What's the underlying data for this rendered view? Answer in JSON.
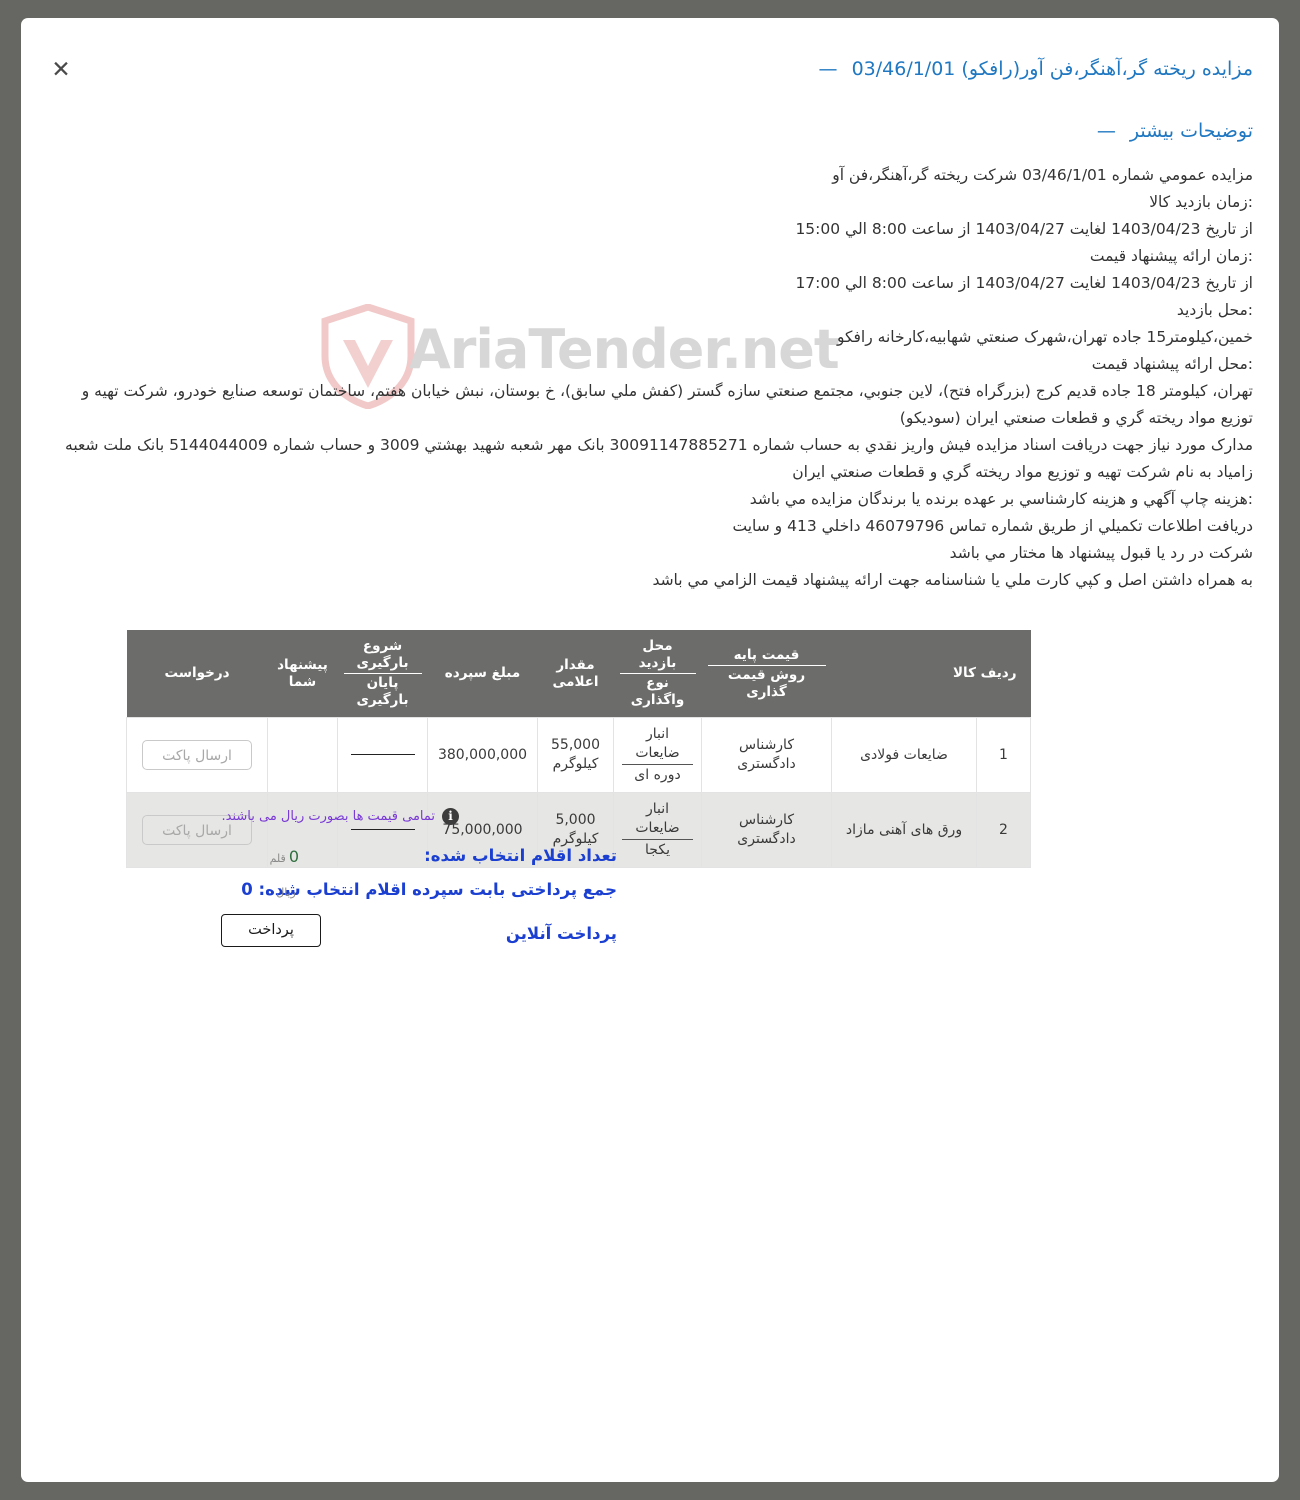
{
  "window": {
    "close_label": "✕",
    "background_color": "#666663",
    "panel_color": "#ffffff"
  },
  "header": {
    "dash": "—",
    "title": "مزایده ریخته گر،آهنگر،فن آور(رافکو) 03/46/1/01",
    "more_details": "توضیحات بیشتر"
  },
  "description": {
    "lines": [
      "مزایده عمومي شماره 03/46/1/01 شرکت ریخته گر،آهنگر،فن آو",
      ":زمان بازدید کالا",
      "از تاریخ 1403/04/23 لغایت 1403/04/27 از ساعت 8:00 الي 15:00",
      ":زمان ارائه پیشنهاد قیمت",
      "از تاریخ 1403/04/23 لغایت 1403/04/27 از ساعت 8:00 الي 17:00",
      ":محل بازدید",
      "خمین،کیلومتر15 جاده تهران،شهرک صنعتي شهابیه،کارخانه رافکو",
      ":محل ارائه پیشنهاد قیمت",
      "تهران، کیلومتر 18 جاده قدیم کرج (بزرگراه فتح)، لاین جنوبي، مجتمع صنعتي سازه گستر (کفش ملي سابق)، خ بوستان، نبش خیابان هفتم، ساختمان توسعه صنایع خودرو، شرکت تهیه و توزیع مواد ریخته گري و قطعات صنعتي ایران (سودیکو)",
      "مدارک مورد نیاز جهت دریافت اسناد مزایده فیش واریز نقدي به حساب شماره 30091147885271 بانک مهر شعبه شهید بهشتي 3009 و حساب شماره 5144044009 بانک ملت شعبه زامیاد به نام شرکت تهیه و توزیع مواد ریخته گري و قطعات صنعتي ایران",
      ":هزینه چاپ آگهي و هزینه کارشناسي بر عهده برنده یا برندگان مزایده مي باشد",
      "دریافت اطلاعات تکمیلي از طریق شماره تماس 46079796 داخلي 413 و سایت",
      "شرکت در رد یا قبول پیشنهاد ها مختار مي باشد",
      "به همراه داشتن اصل و کپي کارت ملي یا شناسنامه جهت ارائه پیشنهاد قیمت الزامي مي باشد"
    ]
  },
  "table": {
    "headers": {
      "row_goods": "ردیف  کالا",
      "base_price_top": "قیمت پایه",
      "base_price_bottom": "روش قیمت گذاری",
      "visit_place_top": "محل بازدید",
      "visit_place_bottom": "نوع واگذاری",
      "declared_amount": "مقدار اعلامی",
      "deposit_amount": "مبلغ سپرده",
      "loading_top": "شروع بارگیری",
      "loading_bottom": "پایان بارگیری",
      "your_offer": "پیشنهاد شما",
      "request": "درخواست"
    },
    "rows": [
      {
        "index": "1",
        "goods": "ضایعات فولادی",
        "base_price_method": "کارشناس دادگستری",
        "visit_place_top": "انبار ضایعات",
        "visit_place_bottom": "دوره ای",
        "declared_amount_top": "55,000",
        "declared_amount_bottom": "کیلوگرم",
        "deposit": "380,000,000",
        "loading": "",
        "your_offer": "",
        "request_label": "ارسال پاکت"
      },
      {
        "index": "2",
        "goods": "ورق های آهنی مازاد",
        "base_price_method": "کارشناس دادگستری",
        "visit_place_top": "انبار ضایعات",
        "visit_place_bottom": "یکجا",
        "declared_amount_top": "5,000",
        "declared_amount_bottom": "کیلوگرم",
        "deposit": "75,000,000",
        "loading": "",
        "your_offer": "",
        "request_label": "ارسال پاکت"
      }
    ]
  },
  "note": {
    "icon": "i",
    "text": "تمامی قیمت ها بصورت ریال می باشند."
  },
  "summary": {
    "selected_items_label": "تعداد اقلام انتخاب شده:",
    "selected_items_value": "0",
    "selected_items_unit": "قلم",
    "total_deposit_label": "جمع پرداختی بابت سپرده اقلام انتخاب شده: 0",
    "total_deposit_unit": "ریال",
    "online_payment_label": "پرداخت آنلاین",
    "pay_button_label": "پرداخت"
  },
  "watermark": {
    "text": "AriaTender.net"
  }
}
